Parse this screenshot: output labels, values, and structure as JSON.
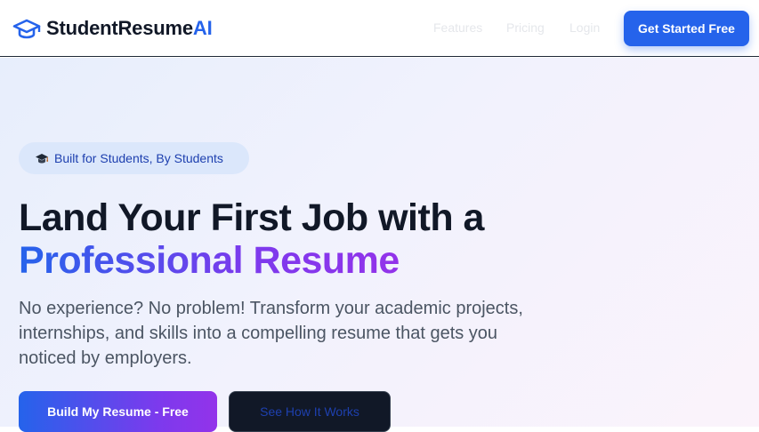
{
  "navbar": {
    "brand_name": "StudentResume",
    "brand_accent": "AI",
    "brand_icon": "graduation-cap-icon",
    "links": [
      "Features",
      "Pricing",
      "Login"
    ],
    "cta_label": "Get Started Free"
  },
  "hero": {
    "badge_icon": "graduation-cap-icon",
    "badge_text": "Built for Students, By Students",
    "headline_line1": "Land Your First Job with a",
    "headline_line2": "Professional Resume",
    "subtext": "No experience? No problem! Transform your academic projects, internships, and skills into a compelling resume that gets you noticed by employers.",
    "primary_button": "Build My Resume - Free",
    "secondary_button": "See How It Works"
  },
  "colors": {
    "brand_blue": "#2563eb",
    "gradient_purple": "#9333ea",
    "heading_dark": "#111827",
    "body_gray": "#4b5563",
    "badge_bg": "#dbe7fb"
  }
}
